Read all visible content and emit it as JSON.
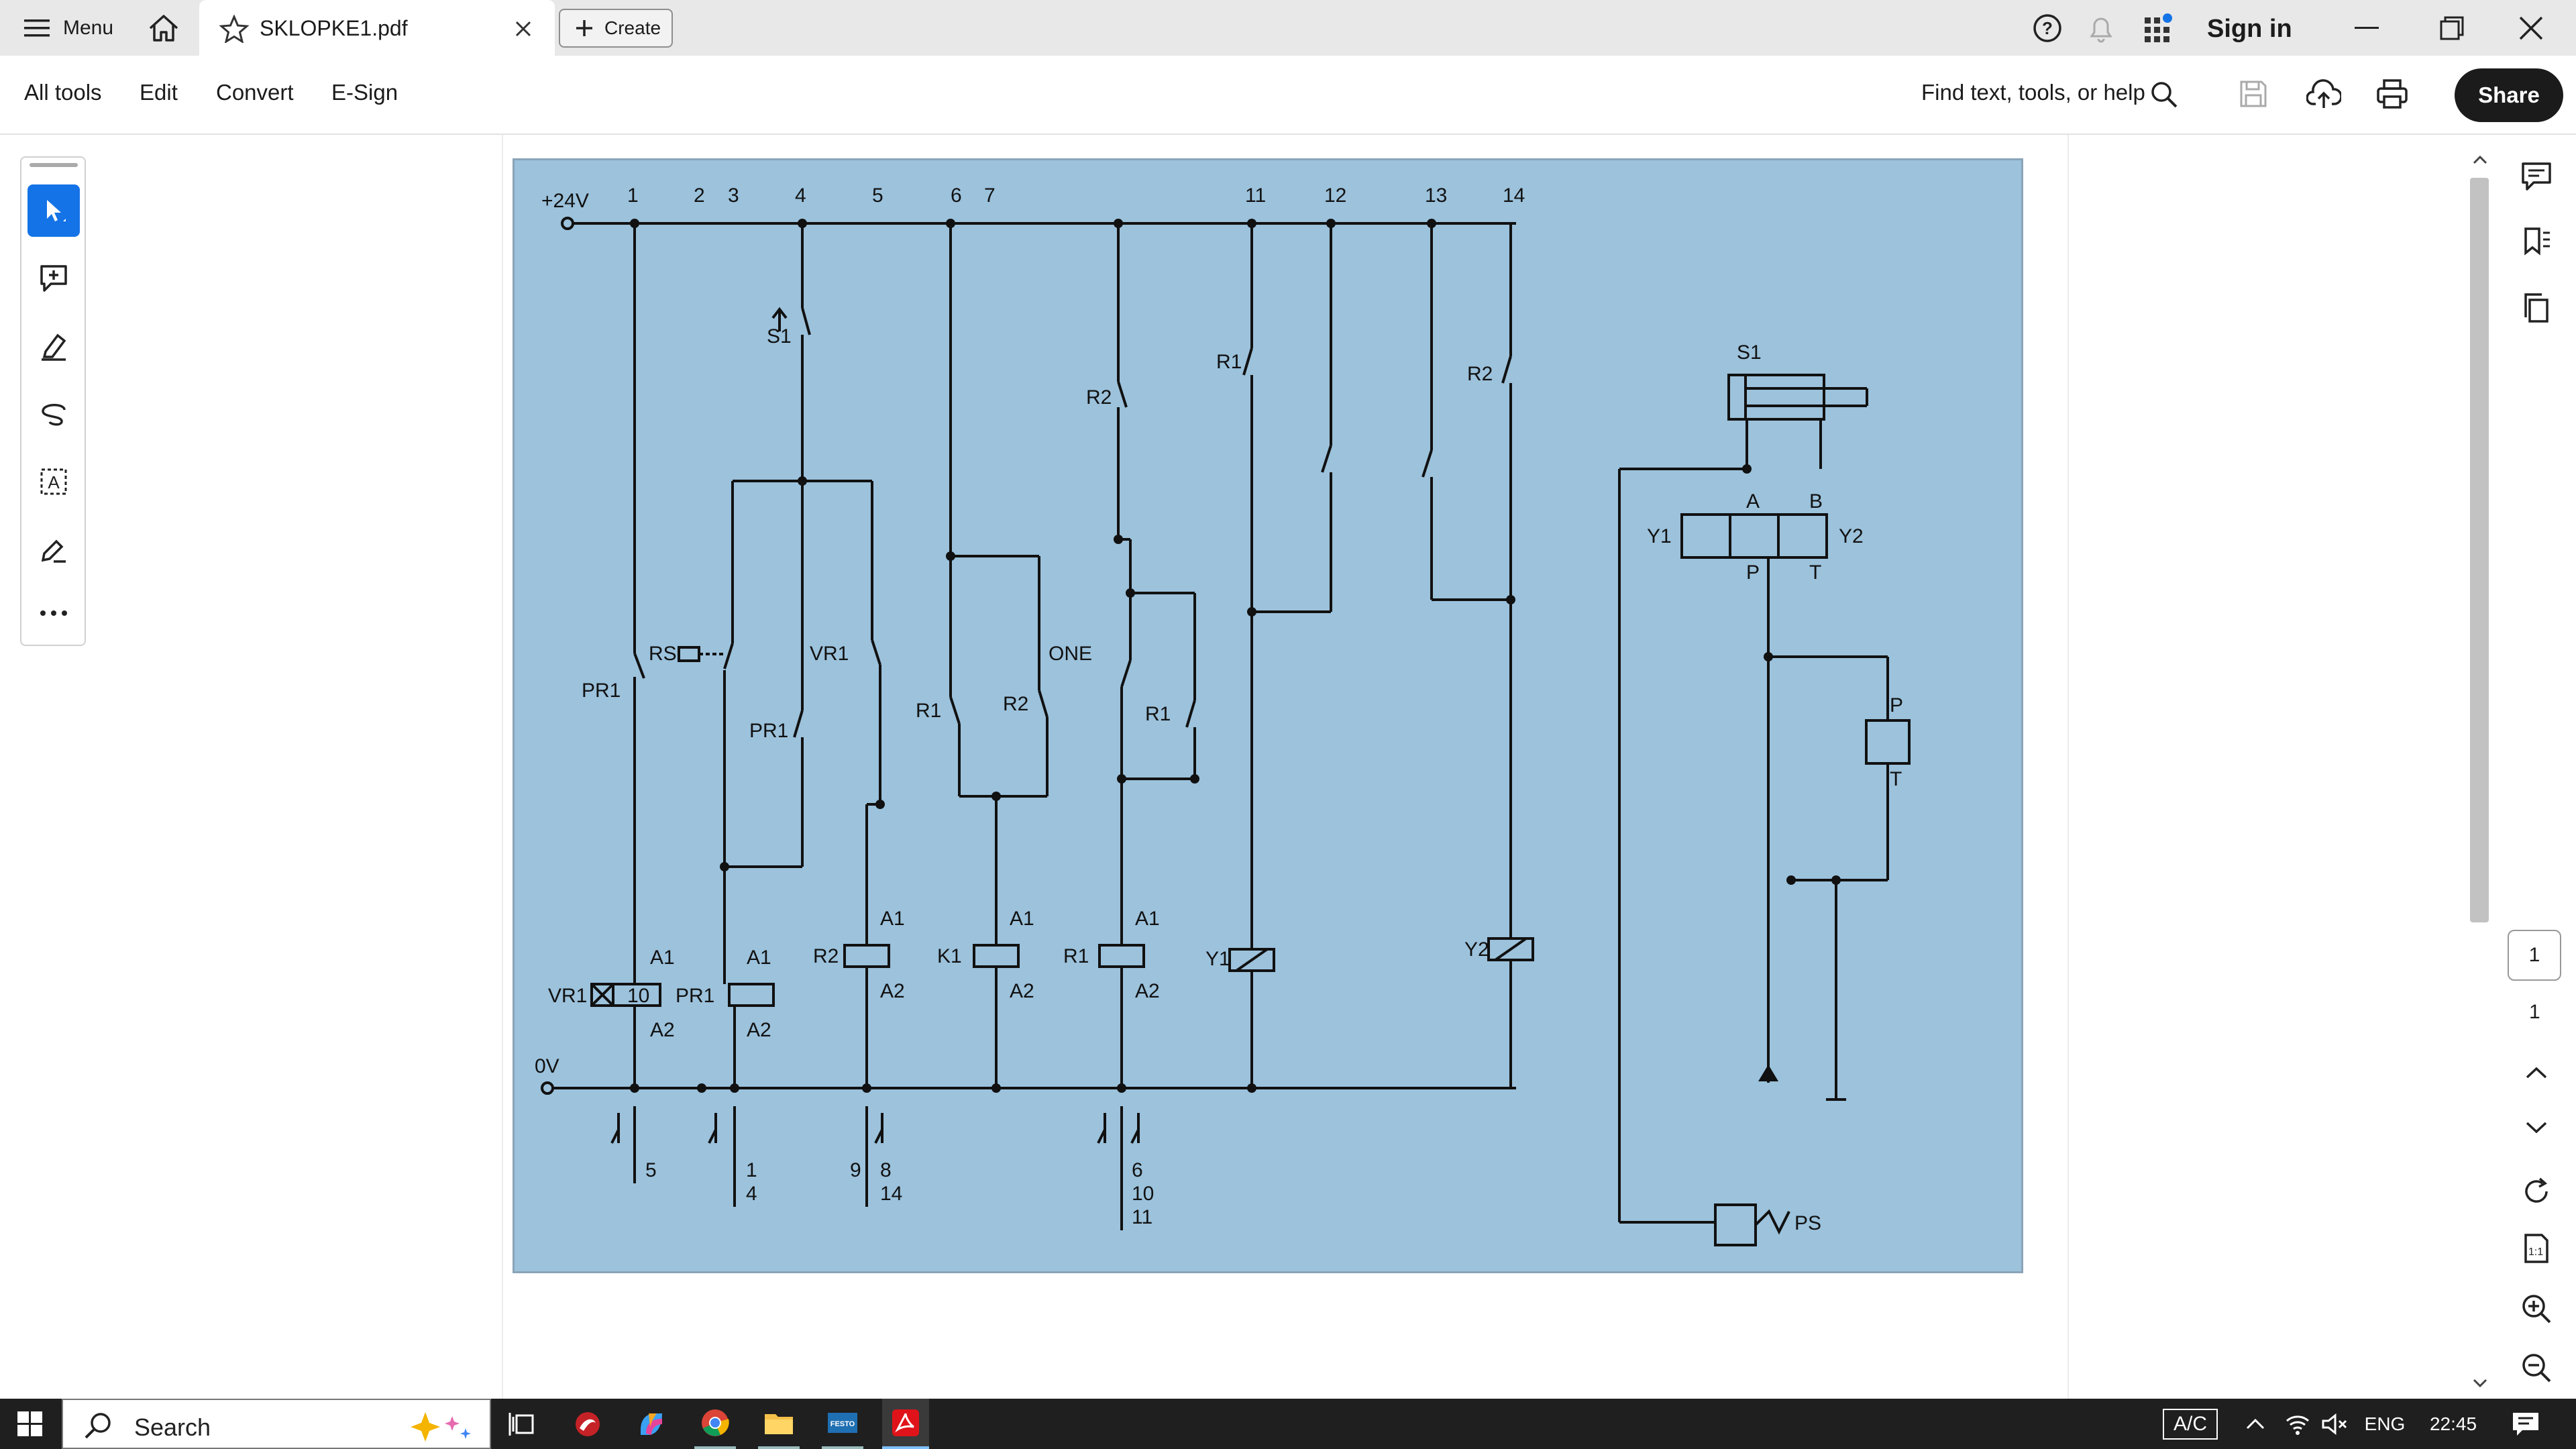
{
  "tabbar": {
    "menu_label": "Menu",
    "tab_title": "SKLOPKE1.pdf",
    "create_label": "Create",
    "sign_in_label": "Sign in"
  },
  "toolbar": {
    "menus": [
      "All tools",
      "Edit",
      "Convert",
      "E-Sign"
    ],
    "find_label": "Find text, tools, or help",
    "share_label": "Share"
  },
  "right_rail": {
    "page_input": "1",
    "page_total": "1"
  },
  "diagram": {
    "supply_plus": "+24V",
    "supply_zero": "0V",
    "column_numbers": [
      "1",
      "2",
      "3",
      "4",
      "5",
      "6",
      "7",
      "11",
      "12",
      "13",
      "14"
    ],
    "labels": {
      "s1_switch": "S1",
      "pr1": "PR1",
      "rs": "RS",
      "vr1": "VR1",
      "one": "ONE",
      "r1": "R1",
      "r2": "R2",
      "k1": "K1",
      "y1": "Y1",
      "y2": "Y2",
      "a1": "A1",
      "a2": "A2",
      "ps": "PS",
      "p": "P",
      "t": "T",
      "a": "A",
      "b": "B"
    },
    "cross_refs": {
      "vr1": [
        "5"
      ],
      "pr1": [
        "1",
        "4"
      ],
      "r2": [
        "9",
        "8",
        "14"
      ],
      "r1": [
        "6",
        "10",
        "11"
      ]
    },
    "vr1_time": "10"
  },
  "taskbar": {
    "search_label": "Search",
    "ac_label": "A/C",
    "lang": "ENG",
    "time": "22:45"
  }
}
